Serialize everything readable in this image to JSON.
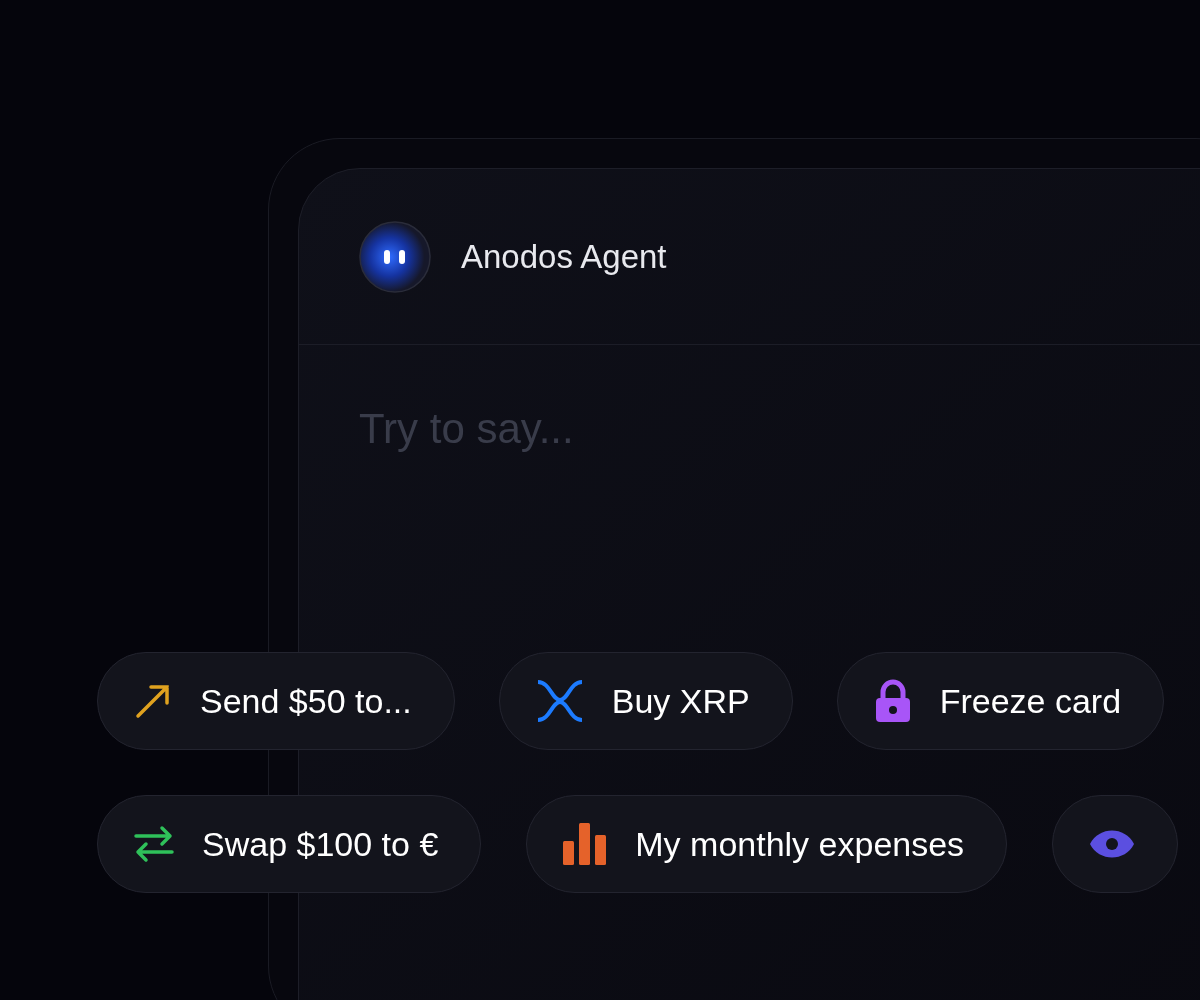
{
  "agent": {
    "name": "Anodos Agent"
  },
  "prompt": {
    "placeholder": "Try to say..."
  },
  "suggestions": [
    [
      {
        "kind": "send",
        "label": "Send $50 to..."
      },
      {
        "kind": "buy",
        "label": "Buy XRP"
      },
      {
        "kind": "freeze",
        "label": "Freeze card"
      }
    ],
    [
      {
        "kind": "swap",
        "label": "Swap $100 to €"
      },
      {
        "kind": "expenses",
        "label": "My monthly expenses"
      },
      {
        "kind": "view"
      }
    ]
  ]
}
